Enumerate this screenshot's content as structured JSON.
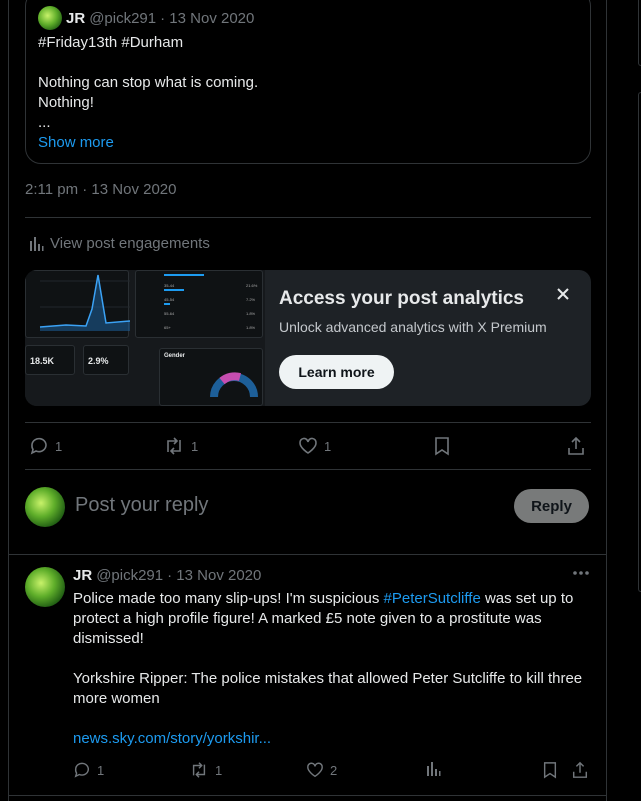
{
  "quoted_tweet": {
    "author_name": "JR",
    "author_handle": "@pick291",
    "date": "· 13 Nov 2020",
    "lines": [
      "#Friday13th #Durham",
      "",
      "Nothing can stop what is coming.",
      "Nothing!",
      "..."
    ],
    "show_more": "Show more"
  },
  "tweet_timestamp": "2:11 pm · 13 Nov 2020",
  "engagements_label": "View post engagements",
  "promo": {
    "title": "Access your post analytics",
    "subtitle": "Unlock advanced analytics with X Premium",
    "button": "Learn more",
    "preview": {
      "stat_1": "18.5K",
      "stat_2": "2.9%",
      "gender_label": "Gender",
      "row_labels": [
        "25-34",
        "35-44",
        "45-54",
        "55-64",
        "65+"
      ],
      "row_values": [
        "40.2%",
        "21.6%",
        "7.2%",
        "1.8%",
        "1.8%"
      ]
    }
  },
  "main_actions": {
    "replies": "1",
    "reposts": "1",
    "likes": "1"
  },
  "composer": {
    "placeholder": "Post your reply",
    "reply_button": "Reply"
  },
  "reply_tweet": {
    "author_name": "JR",
    "author_handle": "@pick291",
    "date": "· 13 Nov 2020",
    "text_1_before": "Police made too many slip-ups! I'm suspicious ",
    "text_1_hashtag": "#PeterSutcliffe",
    "text_1_after": " was set up to protect a high profile figure! A marked £5 note given to a prostitute was dismissed!",
    "text_2": "Yorkshire Ripper: The police mistakes that allowed Peter Sutcliffe to kill three more women",
    "link": "news.sky.com/story/yorkshir...",
    "replies": "1",
    "reposts": "1",
    "likes": "2"
  },
  "colors": {
    "background": "#000000",
    "text": "#e7e9ea",
    "muted": "#71767b",
    "accent": "#1d9bf0",
    "border": "#2f3336"
  }
}
